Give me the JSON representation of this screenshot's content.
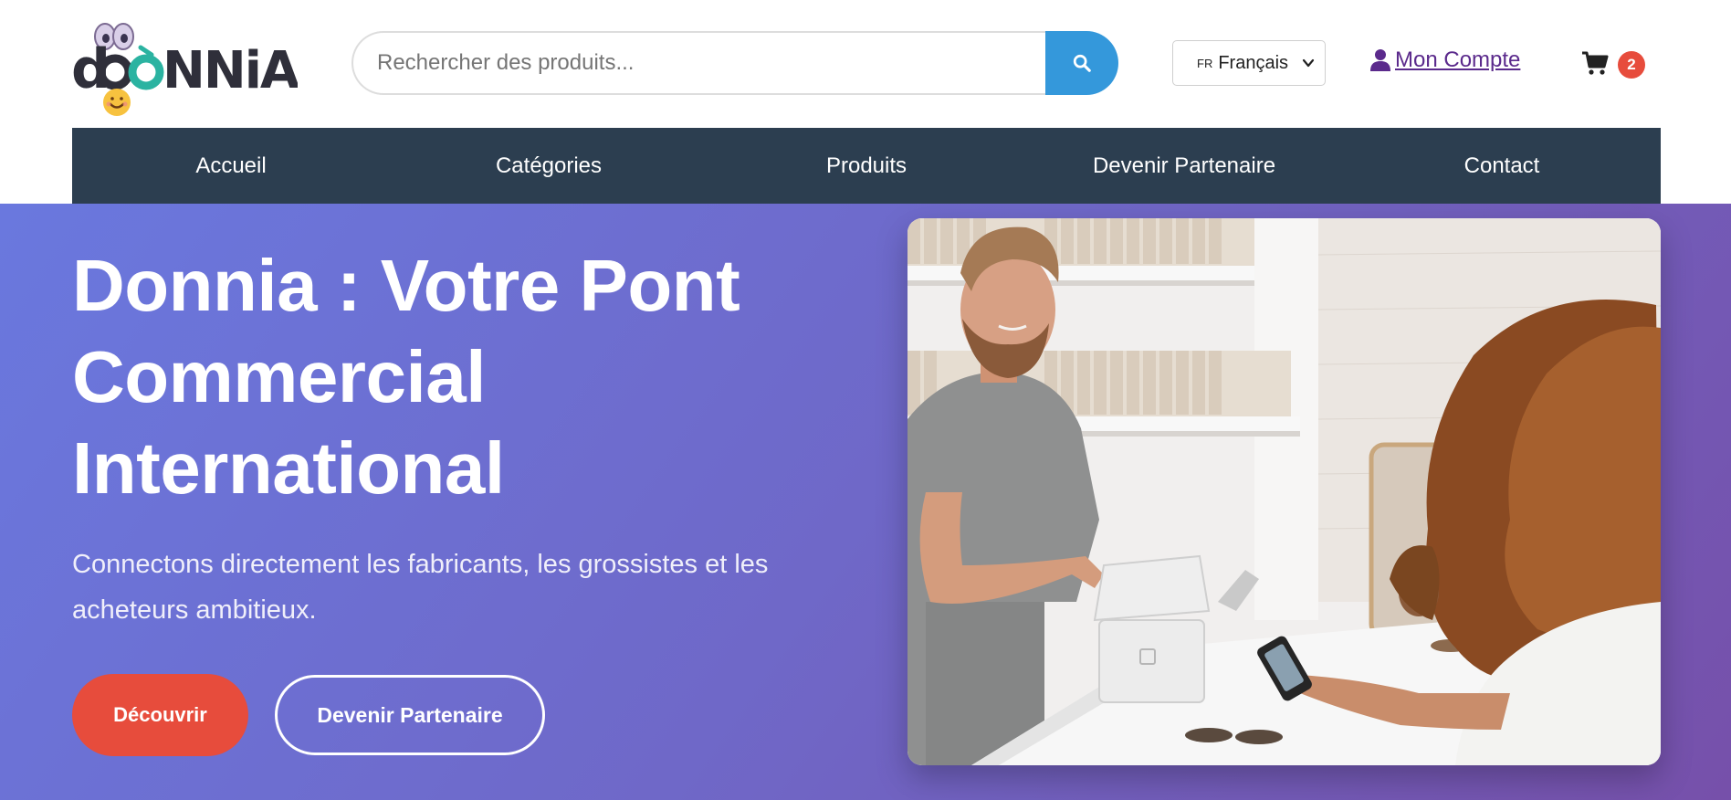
{
  "header": {
    "logo_alt": "doòNNiA",
    "search": {
      "placeholder": "Rechercher des produits...",
      "value": ""
    },
    "language": {
      "flag": "FR",
      "selected": "Français"
    },
    "account_label": "Mon Compte",
    "cart_count": "2"
  },
  "nav": {
    "items": [
      {
        "label": "Accueil"
      },
      {
        "label": "Catégories"
      },
      {
        "label": "Produits"
      },
      {
        "label": "Devenir Partenaire"
      },
      {
        "label": "Contact"
      }
    ]
  },
  "hero": {
    "title": "Donnia : Votre Pont Commercial International",
    "subtitle": "Connectons directement les fabricants, les grossistes et les acheteurs ambitieux.",
    "primary_button": "Découvrir",
    "secondary_button": "Devenir Partenaire"
  },
  "colors": {
    "nav_bg": "#2c3e50",
    "search_button": "#3498db",
    "primary_button": "#e74c3c",
    "cart_badge": "#e74c3c",
    "account_link": "#5b2a8c",
    "hero_gradient_start": "#6a78de",
    "hero_gradient_end": "#7650aa"
  },
  "icons": {
    "search": "search-icon",
    "user": "user-icon",
    "cart": "cart-icon",
    "caret": "chevron-down-icon"
  }
}
